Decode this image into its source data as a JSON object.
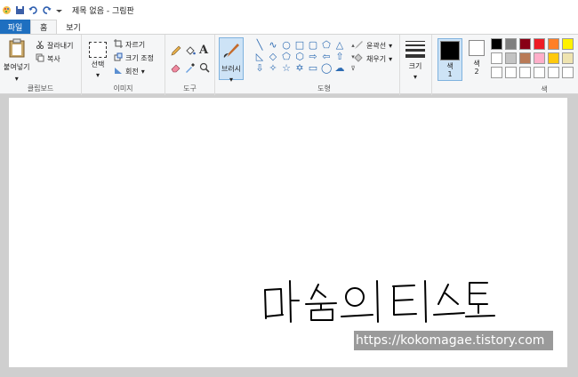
{
  "window": {
    "title": "제목 없음 - 그림판"
  },
  "tabs": {
    "file": "파일",
    "home": "홈",
    "view": "보기"
  },
  "clipboard": {
    "paste": "붙여넣기",
    "cut": "잘라내기",
    "copy": "복사",
    "label": "클립보드"
  },
  "image": {
    "select": "선택",
    "crop": "자르기",
    "resize": "크기 조정",
    "rotate": "회전",
    "label": "이미지"
  },
  "tools": {
    "label": "도구"
  },
  "brushes": {
    "label": "브러시"
  },
  "shapes": {
    "outline": "윤곽선",
    "fill": "채우기",
    "label": "도형"
  },
  "size": {
    "label": "크기"
  },
  "colors": {
    "color1_label": "색\n1",
    "color1": "#000000",
    "color2_label": "색\n2",
    "color2": "#ffffff",
    "label": "색",
    "palette": [
      "#000000",
      "#7f7f7f",
      "#880015",
      "#ed1c24",
      "#ff7f27",
      "#fff200",
      "#ffffff",
      "#c3c3c3",
      "#b97a57",
      "#ffaec9",
      "#ffc90e",
      "#efe4b0",
      "#ffffff",
      "#ffffff",
      "#ffffff",
      "#ffffff",
      "#ffffff",
      "#ffffff"
    ]
  },
  "canvas": {
    "watermark": "https://kokomagae.tistory.com"
  }
}
